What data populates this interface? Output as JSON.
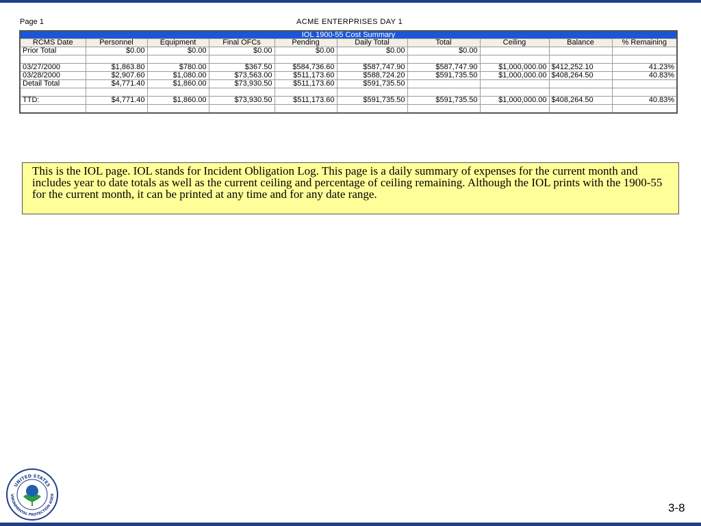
{
  "slide": {
    "page_label": "Page 1",
    "report_title": "ACME ENTERPRISES DAY 1",
    "note": "This is the IOL page.  IOL stands for Incident Obligation Log.  This page is a daily summary of expenses for the current month and includes year to date totals as well as the current ceiling and percentage of ceiling remaining.  Although the IOL prints with the 1900-55 for the current month, it can be printed at any time and for any date range.",
    "slide_number": "3-8",
    "seal": {
      "text_top": "UNITED STATES",
      "text_bottom": "ENVIRONMENTAL PROTECTION AGENCY",
      "icon": "epa-seal-icon"
    }
  },
  "table": {
    "caption": "IOL 1900-55 Cost Summary",
    "headers": [
      "RCMS Date",
      "Personnel",
      "Equipment",
      "Final OFCs",
      "Pending",
      "Daily Total",
      "Total",
      "Ceiling",
      "Balance",
      "% Remaining"
    ],
    "rows": [
      [
        "Prior Total",
        "$0.00",
        "$0.00",
        "$0.00",
        "$0.00",
        "$0.00",
        "$0.00",
        "",
        "",
        ""
      ],
      [
        "",
        "",
        "",
        "",
        "",
        "",
        "",
        "",
        "",
        ""
      ],
      [
        "03/27/2000",
        "$1,863.80",
        "$780.00",
        "$367.50",
        "$584,736.60",
        "$587,747.90",
        "$587,747.90",
        "$1,000,000.00",
        "$412,252.10",
        "41.23%"
      ],
      [
        "03/28/2000",
        "$2,907.60",
        "$1,080.00",
        "$73,563.00",
        "$511,173.60",
        "$588,724.20",
        "$591,735.50",
        "$1,000,000.00",
        "$408,264.50",
        "40.83%"
      ],
      [
        "Detail Total",
        "$4,771.40",
        "$1,860.00",
        "$73,930.50",
        "$511,173.60",
        "$591,735.50",
        "",
        "",
        "",
        ""
      ],
      [
        "",
        "",
        "",
        "",
        "",
        "",
        "",
        "",
        "",
        ""
      ],
      [
        "TTD:",
        "$4,771.40",
        "$1,860.00",
        "$73,930.50",
        "$511,173.60",
        "$591,735.50",
        "$591,735.50",
        "$1,000,000.00",
        "$408,264.50",
        "40.83%"
      ],
      [
        "",
        "",
        "",
        "",
        "",
        "",
        "",
        "",
        "",
        ""
      ]
    ]
  },
  "colors": {
    "accent_bar": "#1f3f8a",
    "table_caption_bg": "#1a56d6",
    "note_bg": "#ffff99"
  }
}
